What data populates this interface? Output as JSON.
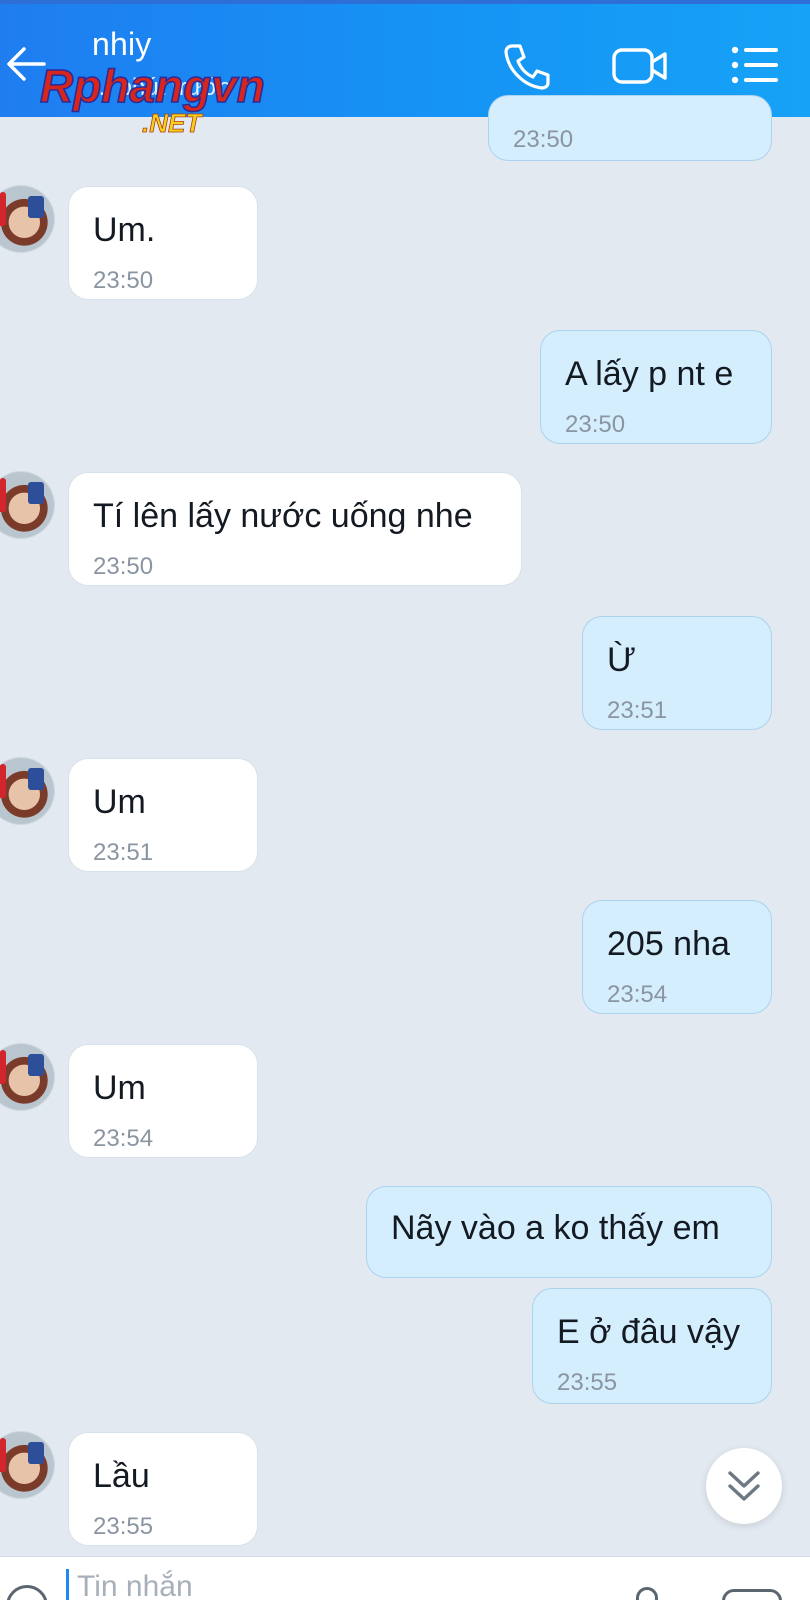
{
  "header": {
    "contact_name": "nhiy",
    "status": "... phút trước",
    "watermark_main": "Rphangvn",
    "watermark_sub": ".NET"
  },
  "icons": {
    "back": "back-arrow-icon",
    "call": "phone-icon",
    "video": "video-camera-icon",
    "menu": "list-menu-icon",
    "scroll": "double-chevron-down-icon"
  },
  "colors": {
    "header": "#1594f5",
    "incoming_bubble": "#ffffff",
    "outgoing_bubble": "#d5eefd",
    "background": "#e2e9f1",
    "timestamp": "#8a95a1"
  },
  "messages": [
    {
      "from": "me",
      "text": "",
      "time": "23:50"
    },
    {
      "from": "them",
      "text": "Um.",
      "time": "23:50"
    },
    {
      "from": "me",
      "text": "A lấy p nt e",
      "time": "23:50"
    },
    {
      "from": "them",
      "text": "Tí lên lấy nước uống nhe",
      "time": "23:50"
    },
    {
      "from": "me",
      "text": "Ừ",
      "time": "23:51"
    },
    {
      "from": "them",
      "text": "Um",
      "time": "23:51"
    },
    {
      "from": "me",
      "text": "205 nha",
      "time": "23:54"
    },
    {
      "from": "them",
      "text": "Um",
      "time": "23:54"
    },
    {
      "from": "me",
      "text": "Nãy vào a ko thấy em",
      "time": ""
    },
    {
      "from": "me",
      "text": "E ở đâu vậy",
      "time": "23:55"
    },
    {
      "from": "them",
      "text": "Lầu",
      "time": "23:55"
    }
  ],
  "composer": {
    "placeholder": "Tin nhắn"
  }
}
